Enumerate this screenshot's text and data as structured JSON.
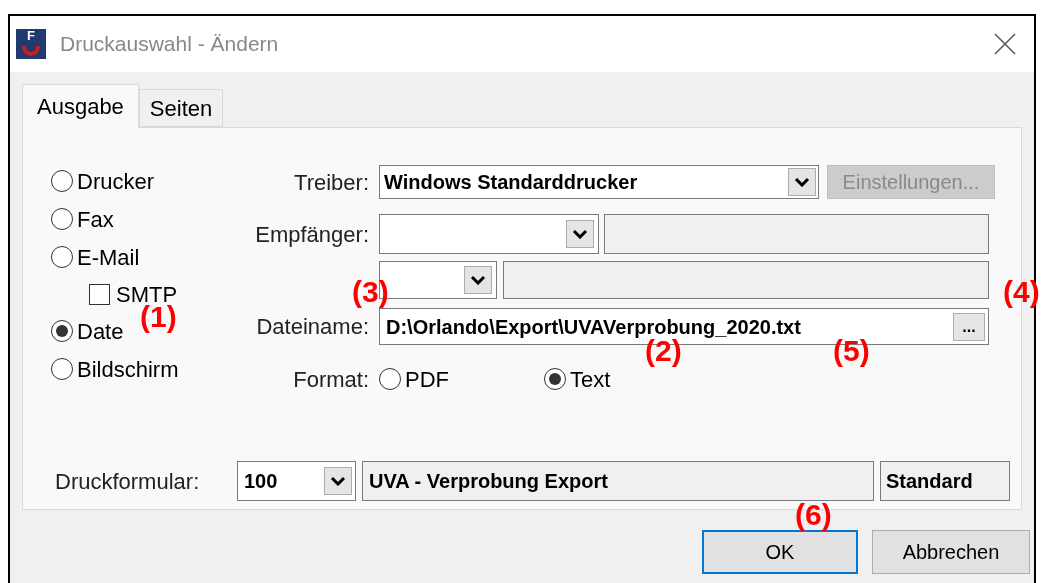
{
  "window": {
    "title": "Druckauswahl - Ändern",
    "app_letter": "F"
  },
  "tabs": [
    {
      "label": "Ausgabe",
      "selected": true
    },
    {
      "label": "Seiten",
      "selected": false
    }
  ],
  "output_options": [
    {
      "kind": "radio",
      "label": "Drucker",
      "selected": false
    },
    {
      "kind": "radio",
      "label": "Fax",
      "selected": false
    },
    {
      "kind": "radio",
      "label": "E-Mail",
      "selected": false
    },
    {
      "kind": "checkbox",
      "label": "SMTP",
      "checked": false
    },
    {
      "kind": "radio",
      "label": "Date",
      "selected": true
    },
    {
      "kind": "radio",
      "label": "Bildschirm",
      "selected": false
    }
  ],
  "driver": {
    "label": "Treiber:",
    "value": "Windows Standarddrucker"
  },
  "settings_button": {
    "label": "Einstellungen...",
    "disabled": true
  },
  "recipient": {
    "label": "Empfänger:"
  },
  "filename": {
    "label": "Dateiname:",
    "value": "D:\\Orlando\\Export\\UVAVerprobung_2020.txt",
    "browse": "..."
  },
  "format": {
    "label": "Format:",
    "options": [
      {
        "label": "PDF",
        "selected": false
      },
      {
        "label": "Text",
        "selected": true
      }
    ]
  },
  "print_form": {
    "label": "Druckformular:",
    "number": "100",
    "name": "UVA - Verprobung Export",
    "variant": "Standard"
  },
  "buttons": [
    {
      "label": "OK",
      "default": true
    },
    {
      "label": "Abbrechen",
      "default": false
    }
  ],
  "callouts": [
    "(1)",
    "(2)",
    "(3)",
    "(4)",
    "(5)",
    "(6)"
  ]
}
